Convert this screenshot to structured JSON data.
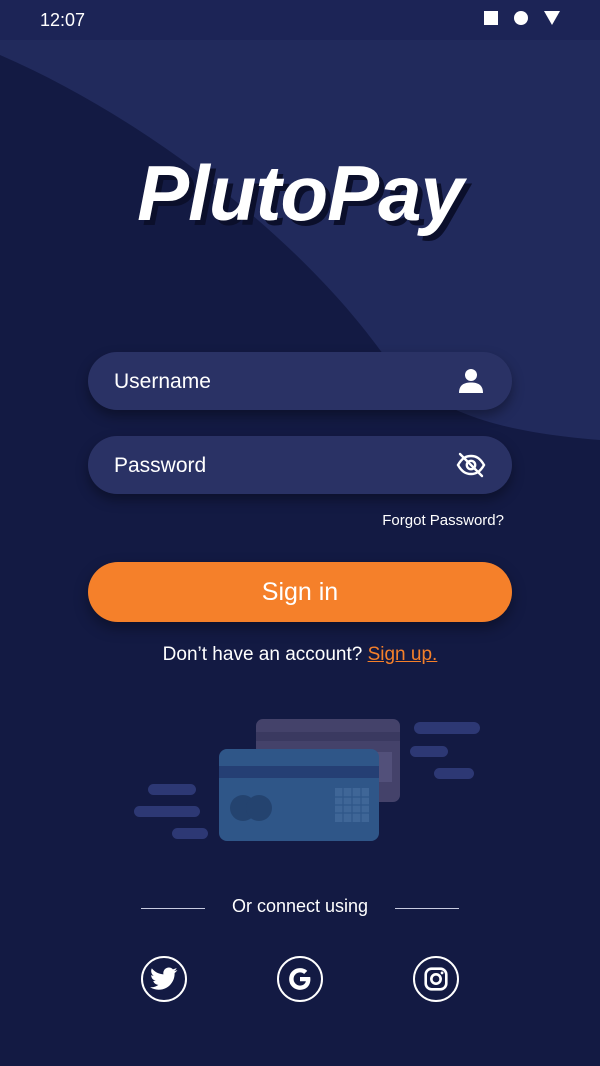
{
  "status_bar": {
    "time": "12:07",
    "icons": [
      "stop-square-icon",
      "circle-icon",
      "signal-triangle-icon"
    ]
  },
  "app": {
    "logo_text": "PlutoPay"
  },
  "form": {
    "username_placeholder": "Username",
    "password_placeholder": "Password",
    "username_icon": "user-icon",
    "password_icon": "eye-off-icon",
    "forgot_password": "Forgot Password?",
    "sign_in_label": "Sign in",
    "no_account_text": "Don’t have an account?",
    "sign_up_link": "Sign up."
  },
  "social": {
    "divider_text": "Or connect using",
    "providers": [
      "twitter-icon",
      "google-icon",
      "instagram-icon"
    ]
  },
  "colors": {
    "background": "#131a43",
    "accent": "#f5802a",
    "field": "#2a3265"
  }
}
